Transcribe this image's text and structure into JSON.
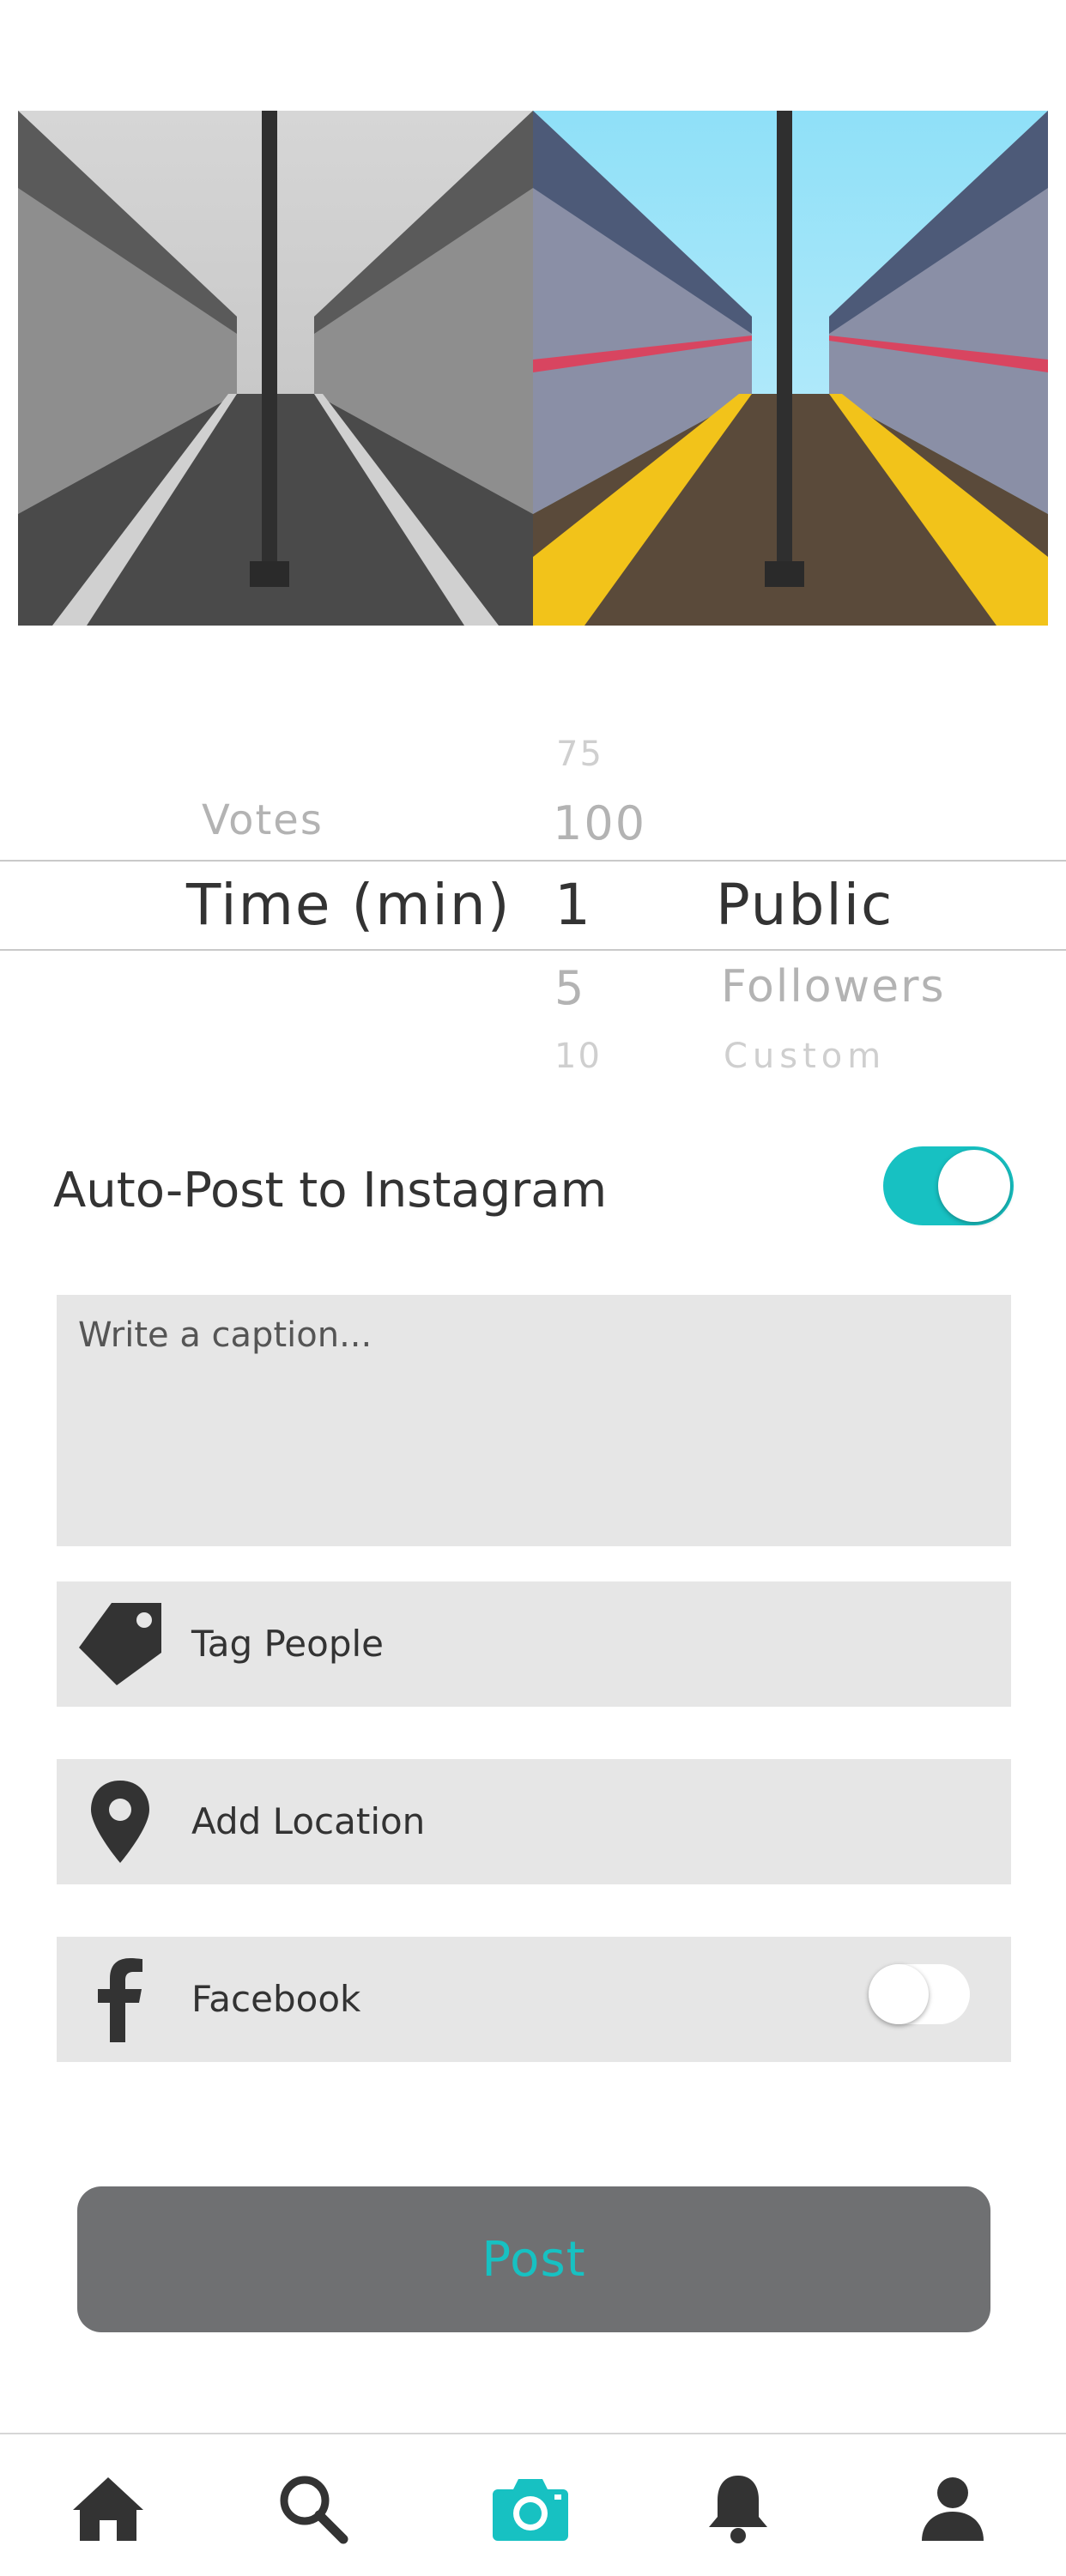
{
  "picker": {
    "col1": {
      "above": "Votes",
      "selected": "Time (min)"
    },
    "col2": {
      "above2": "75",
      "above1": "100",
      "selected": "1",
      "below1": "5",
      "below2": "10"
    },
    "col3": {
      "selected": "Public",
      "below1": "Followers",
      "below2": "Custom"
    }
  },
  "auto_post": {
    "label": "Auto-Post to Instagram",
    "enabled": true
  },
  "caption": {
    "placeholder": "Write a caption..."
  },
  "options": [
    {
      "label": "Tag People",
      "icon": "tag-icon"
    },
    {
      "label": "Add Location",
      "icon": "location-pin-icon"
    },
    {
      "label": "Facebook",
      "icon": "facebook-icon",
      "toggle_enabled": false
    }
  ],
  "post_button": {
    "label": "Post"
  },
  "tabbar": {
    "items": [
      {
        "icon": "home-icon",
        "active": false
      },
      {
        "icon": "search-icon",
        "active": false
      },
      {
        "icon": "camera-icon",
        "active": true
      },
      {
        "icon": "bell-icon",
        "active": false
      },
      {
        "icon": "profile-icon",
        "active": false
      }
    ]
  },
  "colors": {
    "accent": "#17c1c2",
    "icon_dark": "#333333",
    "field_bg": "#e6e6e6",
    "button_bg": "#6f7072"
  }
}
